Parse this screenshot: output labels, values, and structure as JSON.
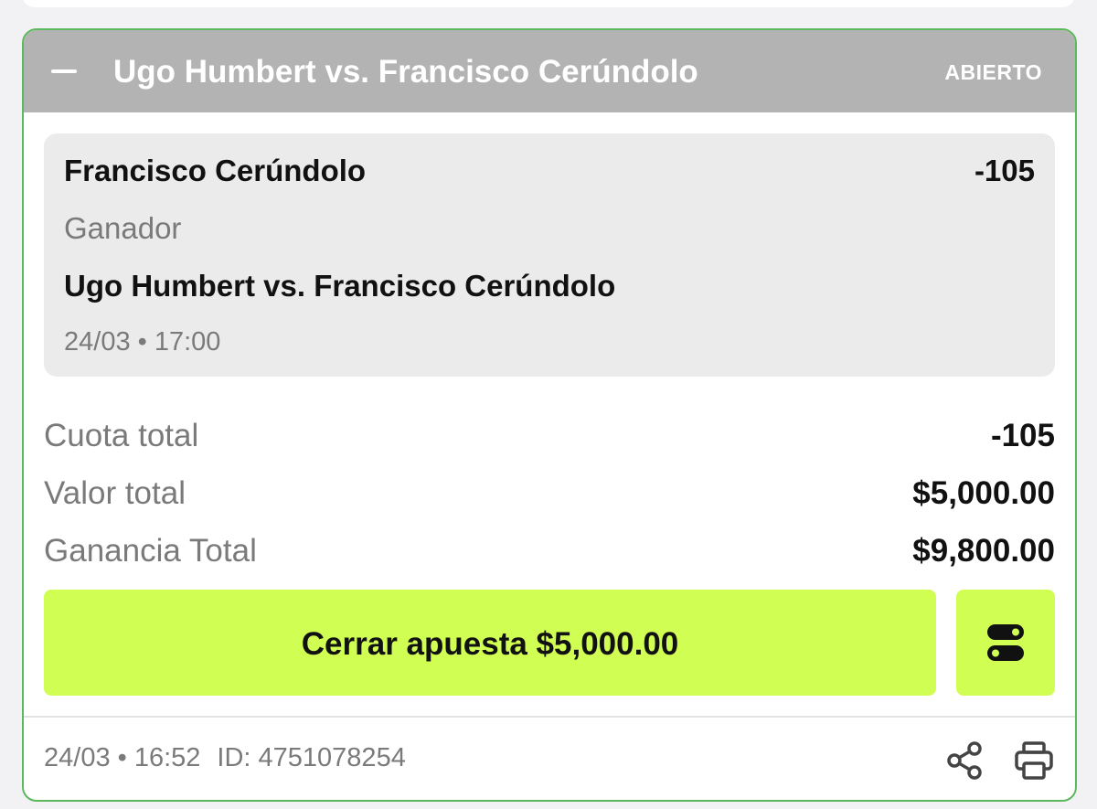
{
  "header": {
    "title": "Ugo Humbert vs. Francisco Cerúndolo",
    "status": "ABIERTO"
  },
  "selection": {
    "name": "Francisco Cerúndolo",
    "odds": "-105",
    "market": "Ganador",
    "event": "Ugo Humbert vs. Francisco Cerúndolo",
    "datetime": "24/03 • 17:00"
  },
  "summary": {
    "rows": [
      {
        "label": "Cuota total",
        "value": "-105"
      },
      {
        "label": "Valor total",
        "value": "$5,000.00"
      },
      {
        "label": "Ganancia Total",
        "value": "$9,800.00"
      }
    ]
  },
  "actions": {
    "cashout_label": "Cerrar apuesta $5,000.00",
    "toggle_icon": "toggle-icon",
    "share_icon": "share-icon",
    "print_icon": "print-icon"
  },
  "footer": {
    "datetime": "24/03 • 16:52",
    "id": "ID: 4751078254"
  },
  "colors": {
    "card_border": "#5cb85c",
    "header_bg": "#b3b3b3",
    "accent_button": "#d1fe52",
    "selection_bg": "#ebebeb"
  }
}
